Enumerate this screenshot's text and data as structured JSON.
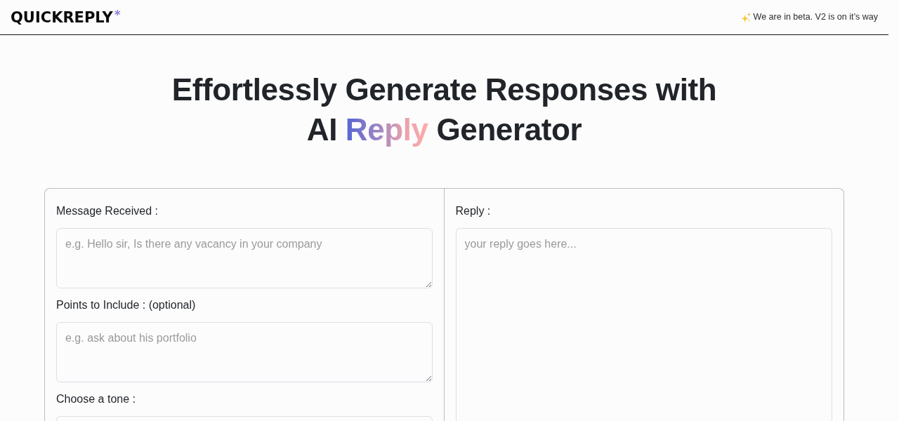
{
  "header": {
    "logo": {
      "text": "QUICKREPLY",
      "mark": "*"
    },
    "notice": "We are in beta. V2 is on it’s way"
  },
  "headline": {
    "line_1": "Effortlessly Generate Responses with",
    "line_2_before": "AI",
    "highlight": "Reply",
    "line_2_after": "Generator"
  },
  "form": {
    "fields": [
      {
        "kind": "textarea",
        "label": "Message Received :",
        "placeholder": "e.g. Hello sir, Is there any vacancy in your company"
      },
      {
        "kind": "textarea",
        "label": "Points to Include : (optional)",
        "placeholder": "e.g. ask about his portfolio"
      },
      {
        "kind": "select",
        "label": "Choose a tone :"
      }
    ]
  },
  "output": {
    "label": "Reply :",
    "placeholder": "your reply goes here..."
  }
}
